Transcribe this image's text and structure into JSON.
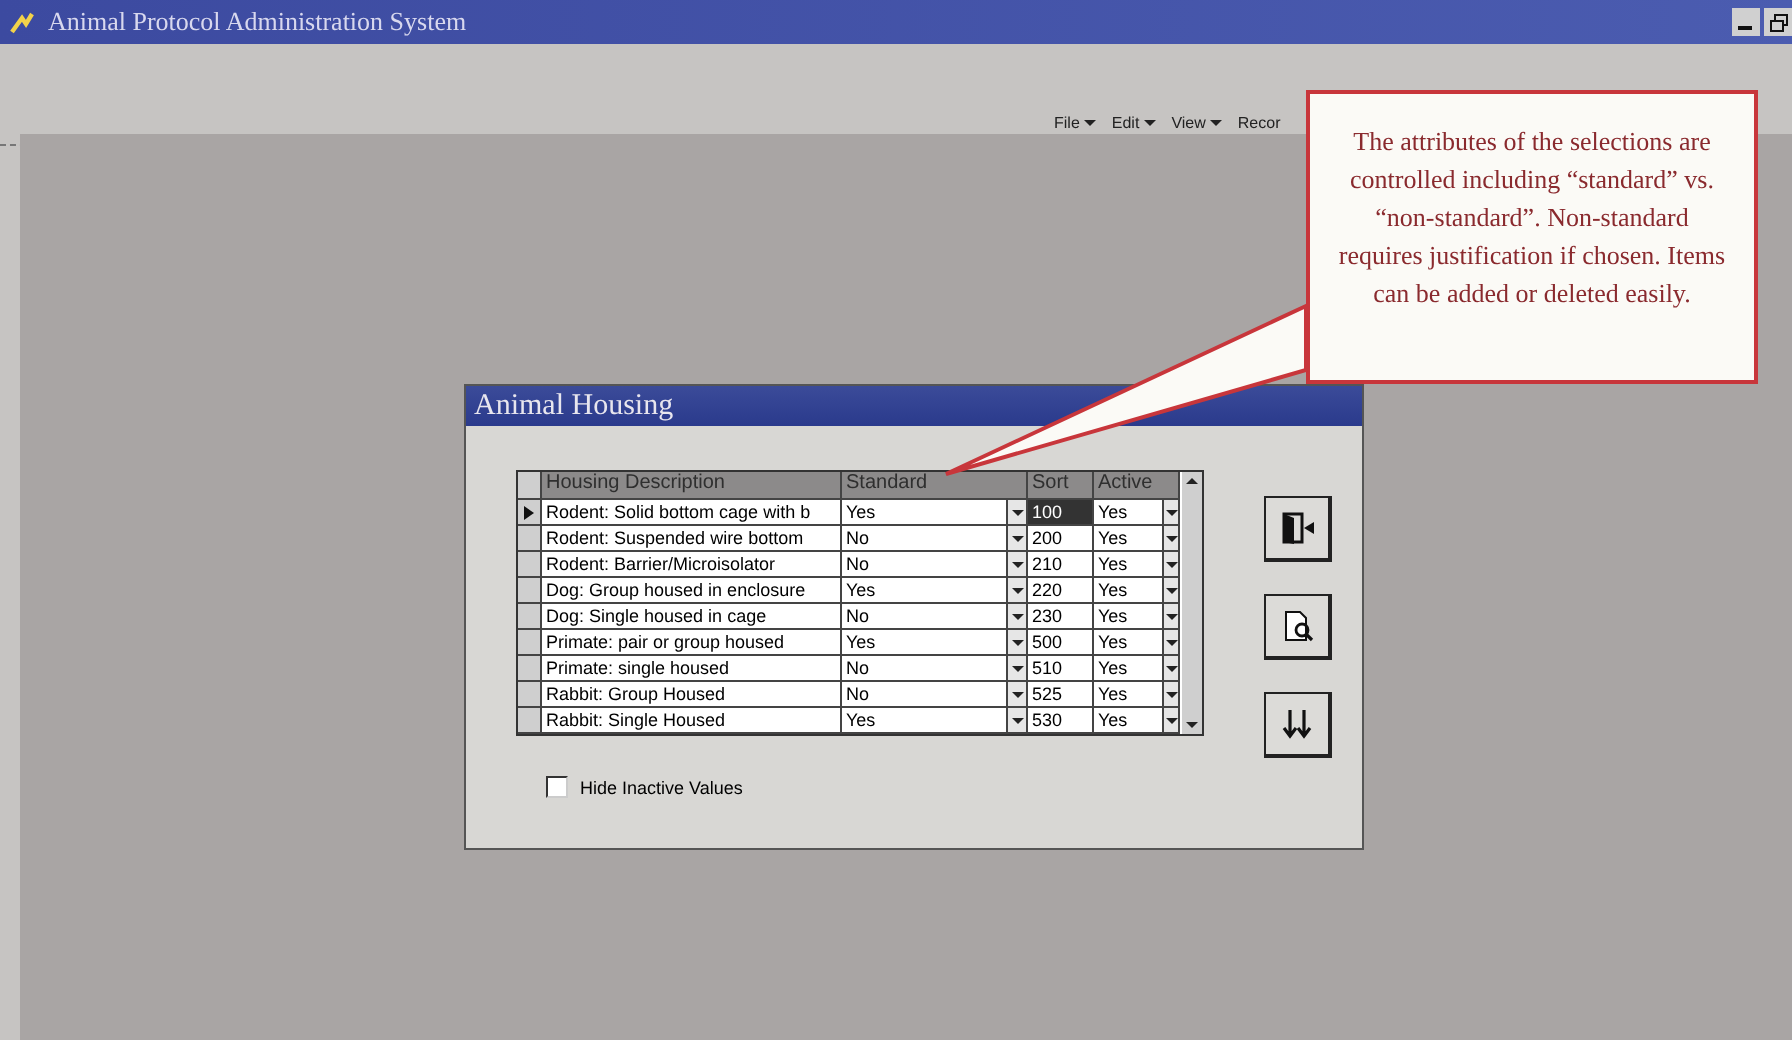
{
  "window": {
    "title": "Animal Protocol Administration System"
  },
  "menu": [
    {
      "label": "File",
      "dropdown": true
    },
    {
      "label": "Edit",
      "dropdown": true
    },
    {
      "label": "View",
      "dropdown": true
    },
    {
      "label": "Recor",
      "dropdown": false
    }
  ],
  "dialog": {
    "title": "Animal Housing",
    "columns": [
      "Housing Description",
      "Standard",
      "Sort",
      "Active"
    ],
    "rows": [
      {
        "description": "Rodent: Solid bottom cage with b",
        "standard": "Yes",
        "sort": "100",
        "active": "Yes",
        "selected": true
      },
      {
        "description": "Rodent: Suspended wire bottom",
        "standard": "No",
        "sort": "200",
        "active": "Yes",
        "selected": false
      },
      {
        "description": "Rodent: Barrier/Microisolator",
        "standard": "No",
        "sort": "210",
        "active": "Yes",
        "selected": false
      },
      {
        "description": "Dog: Group housed in enclosure",
        "standard": "Yes",
        "sort": "220",
        "active": "Yes",
        "selected": false
      },
      {
        "description": "Dog: Single housed in cage",
        "standard": "No",
        "sort": "230",
        "active": "Yes",
        "selected": false
      },
      {
        "description": "Primate: pair or group housed",
        "standard": "Yes",
        "sort": "500",
        "active": "Yes",
        "selected": false
      },
      {
        "description": "Primate: single housed",
        "standard": "No",
        "sort": "510",
        "active": "Yes",
        "selected": false
      },
      {
        "description": "Rabbit: Group Housed",
        "standard": "No",
        "sort": "525",
        "active": "Yes",
        "selected": false
      },
      {
        "description": "Rabbit: Single Housed",
        "standard": "Yes",
        "sort": "530",
        "active": "Yes",
        "selected": false
      }
    ],
    "buttons": [
      {
        "kind": "exit"
      },
      {
        "kind": "preview"
      },
      {
        "kind": "sort"
      }
    ],
    "checkbox": {
      "label": "Hide Inactive Values",
      "checked": false
    }
  },
  "callout": {
    "text": "The attributes of the selections are controlled including “standard” vs. “non-standard”. Non-standard requires justification if chosen.  Items can be added or deleted easily."
  }
}
